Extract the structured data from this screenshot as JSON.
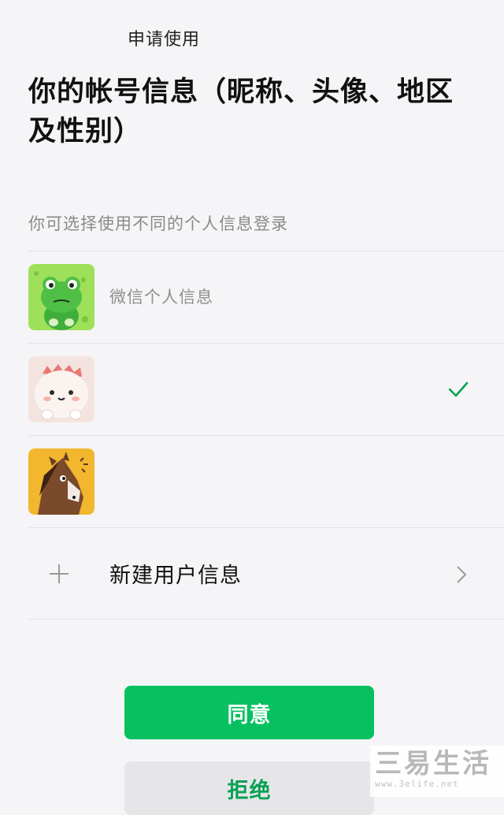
{
  "header": {
    "app_name": "申请使用",
    "title": "你的帐号信息（昵称、头像、地区及性别）",
    "subtitle": "你可选择使用不同的个人信息登录"
  },
  "profiles": [
    {
      "label": "微信个人信息",
      "avatar_icon": "frog-avatar-icon",
      "avatar_bg": "#9ee05a",
      "selected": false
    },
    {
      "label": "",
      "avatar_icon": "cute-creature-avatar-icon",
      "avatar_bg": "#f4e4e0",
      "selected": true
    },
    {
      "label": "",
      "avatar_icon": "horse-avatar-icon",
      "avatar_bg": "#f2b62f",
      "selected": false
    }
  ],
  "add_profile": {
    "label": "新建用户信息",
    "icon": "plus-icon",
    "chevron": "chevron-right-icon"
  },
  "buttons": {
    "agree_label": "同意",
    "reject_label": "拒绝"
  },
  "watermark": {
    "text": "三易生活",
    "url": "www.3elife.net"
  },
  "colors": {
    "accent": "#07c160",
    "check": "#07a153",
    "background": "#f5f5f7"
  }
}
